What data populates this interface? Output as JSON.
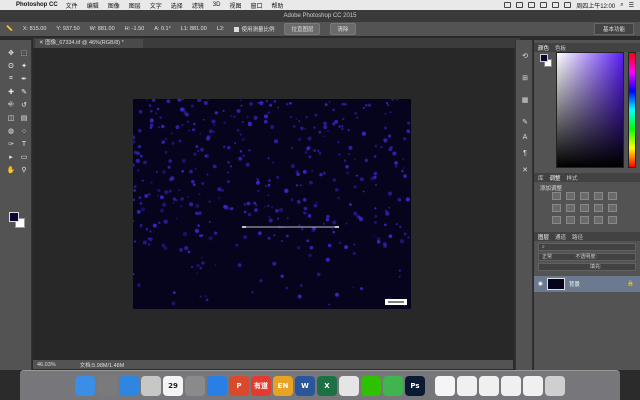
{
  "menubar": {
    "app_name": "Photoshop CC",
    "items": [
      "文件",
      "编辑",
      "图像",
      "图层",
      "文字",
      "选择",
      "滤镜",
      "3D",
      "视图",
      "窗口",
      "帮助"
    ],
    "clock": "周四上午12:00"
  },
  "window": {
    "title": "Adobe Photoshop CC 2015"
  },
  "options_bar": {
    "x": "X: 815.00",
    "y": "Y: 937.50",
    "w": "W: 881.00",
    "h": "H: -1.50",
    "a": "A: 0.1°",
    "l1": "L1: 881.00",
    "l2": "L2:",
    "use_scale_label": "使用测量比例",
    "straighten_label": "拉直图层",
    "clear_label": "清除",
    "workspace_label": "基本功能"
  },
  "document": {
    "tab_title": "图像_67334.tif @ 46%(RGB/8) *"
  },
  "status_bar": {
    "zoom": "46.03%",
    "doc_info": "文档:5.98M/1.48M"
  },
  "panels": {
    "color_tabs": [
      "颜色",
      "色板"
    ],
    "adjust_tabs": [
      "库",
      "调整",
      "样式"
    ],
    "adjust_title": "添加调整",
    "layer_tabs": [
      "图层",
      "通道",
      "路径"
    ],
    "blend_mode": "正常",
    "opacity_label": "不透明度:",
    "fill_label": "填充:",
    "layer_name": "背景"
  },
  "colors": {
    "foreground": "#0a0830",
    "background": "#ffffff",
    "image_bg": "#06031c",
    "dots": "#3c2bd8"
  },
  "tools": [
    "move-icon",
    "marquee-icon",
    "lasso-icon",
    "magic-wand-icon",
    "crop-icon",
    "eyedropper-icon",
    "healing-icon",
    "brush-icon",
    "stamp-icon",
    "history-brush-icon",
    "eraser-icon",
    "gradient-icon",
    "blur-icon",
    "dodge-icon",
    "pen-icon",
    "type-icon",
    "path-select-icon",
    "shape-icon",
    "hand-icon",
    "zoom-icon"
  ],
  "dock_icons": [
    {
      "name": "finder-icon",
      "label": "",
      "color": "#3a8ee6"
    },
    {
      "name": "launchpad-icon",
      "label": "",
      "color": "#7a7a7a"
    },
    {
      "name": "safari-icon",
      "label": "",
      "color": "#2f86e0"
    },
    {
      "name": "photos-icon",
      "label": "",
      "color": "#c7c7c7"
    },
    {
      "name": "calendar-icon",
      "label": "29",
      "color": "#f4f4f4"
    },
    {
      "name": "settings-icon",
      "label": "",
      "color": "#8a8a8a"
    },
    {
      "name": "appstore-icon",
      "label": "",
      "color": "#2a7fe6"
    },
    {
      "name": "wps-icon",
      "label": "P",
      "color": "#d84a2b"
    },
    {
      "name": "youdao-icon",
      "label": "有道",
      "color": "#e33b2f"
    },
    {
      "name": "dict-icon",
      "label": "EN",
      "color": "#e8a324"
    },
    {
      "name": "word-icon",
      "label": "W",
      "color": "#2b579a"
    },
    {
      "name": "excel-icon",
      "label": "X",
      "color": "#1d7044"
    },
    {
      "name": "chrome-icon",
      "label": "",
      "color": "#e5e5e5"
    },
    {
      "name": "wechat-icon",
      "label": "",
      "color": "#2dc100"
    },
    {
      "name": "qq-icon",
      "label": "",
      "color": "#3fb44f"
    },
    {
      "name": "photoshop-icon",
      "label": "Ps",
      "color": "#0b1a33"
    },
    {
      "name": "preview-icon",
      "label": "",
      "color": "#f5f5f5"
    },
    {
      "name": "doc1-icon",
      "label": "",
      "color": "#f0f0f0"
    },
    {
      "name": "doc2-icon",
      "label": "",
      "color": "#f0f0f0"
    },
    {
      "name": "doc3-icon",
      "label": "",
      "color": "#f0f0f0"
    },
    {
      "name": "doc4-icon",
      "label": "",
      "color": "#f0f0f0"
    },
    {
      "name": "trash-icon",
      "label": "",
      "color": "#cfcfcf"
    }
  ]
}
